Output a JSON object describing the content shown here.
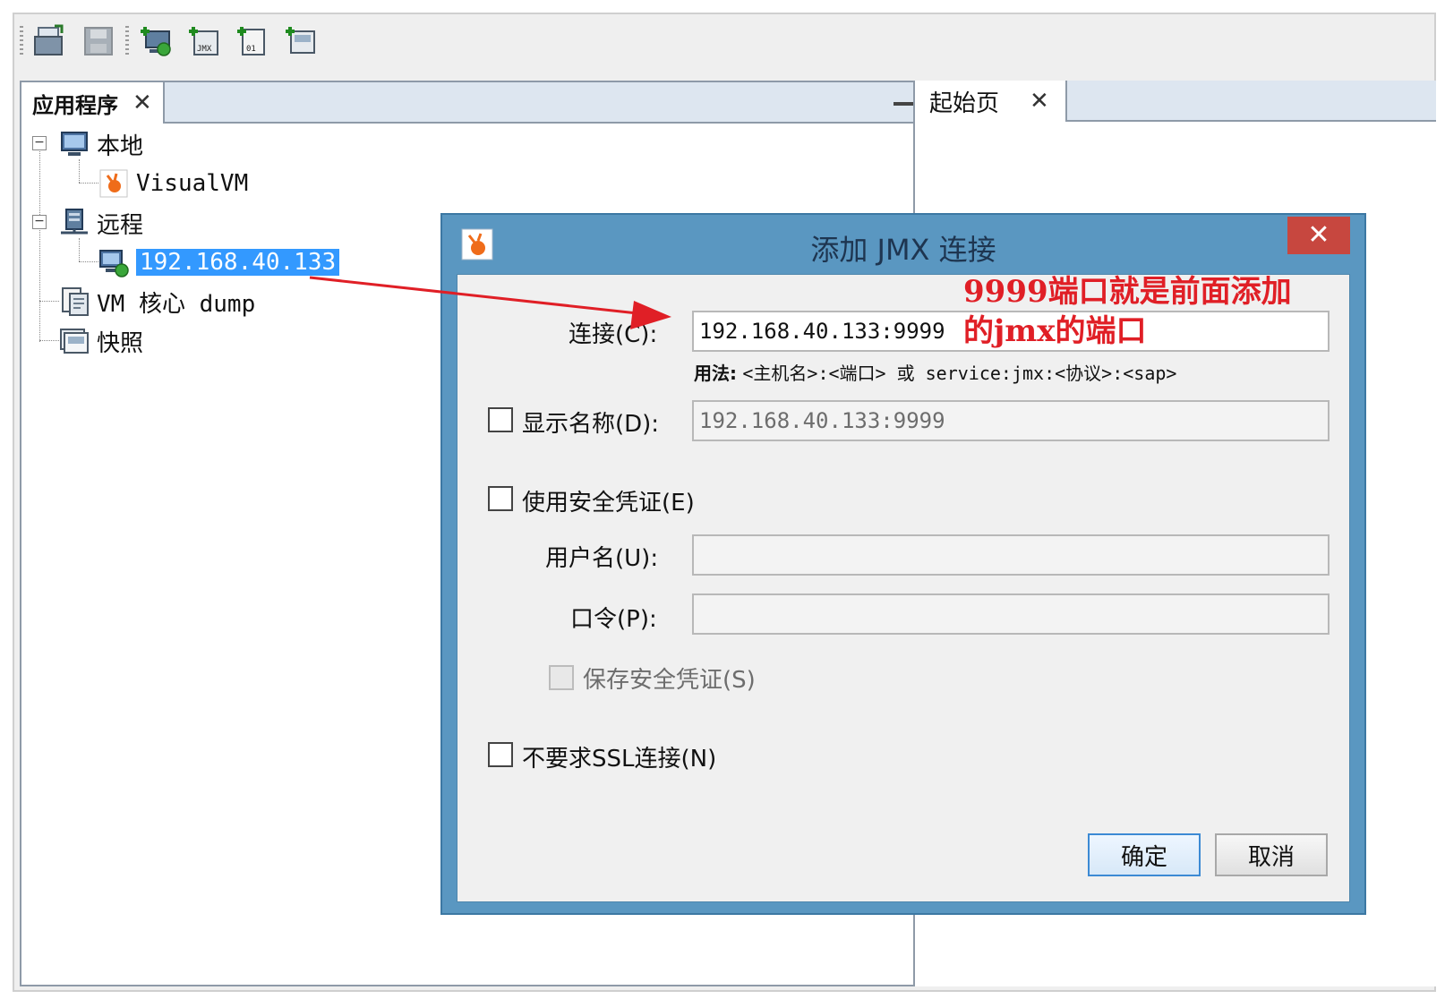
{
  "colors": {
    "selection": "#3399ff",
    "dialog_frame": "#5a97c1",
    "close_button": "#c7473f",
    "annotation": "#e01f26"
  },
  "toolbar": {
    "buttons": [
      {
        "name": "load-icon"
      },
      {
        "name": "save-icon"
      },
      {
        "name": "add-remote-host-icon"
      },
      {
        "name": "add-jmx-connection-icon"
      },
      {
        "name": "load-vm-coredump-icon"
      },
      {
        "name": "add-snapshot-icon"
      }
    ]
  },
  "left_panel": {
    "tab_label": "应用程序",
    "tab_close": "✕",
    "tree": {
      "local": "本地",
      "visualvm": "VisualVM",
      "remote": "远程",
      "remote_host": "192.168.40.133",
      "coredump": "VM 核心 dump",
      "snapshots": "快照"
    }
  },
  "right_panel": {
    "tab_label": "起始页",
    "tab_close": "✕"
  },
  "dialog": {
    "title": "添加 JMX 连接",
    "close": "✕",
    "connection_label": "连接(C):",
    "connection_value": "192.168.40.133:9999",
    "usage_prefix": "用法:",
    "usage_text": "<主机名>:<端口> 或 service:jmx:<协议>:<sap>",
    "display_name_label": "显示名称(D):",
    "display_name_value": "192.168.40.133:9999",
    "use_credentials_label": "使用安全凭证(E)",
    "username_label": "用户名(U):",
    "password_label": "口令(P):",
    "save_credentials_label": "保存安全凭证(S)",
    "no_ssl_label": "不要求SSL连接(N)",
    "ok_label": "确定",
    "cancel_label": "取消"
  },
  "annotation": {
    "line1": "9999端口就是前面添加",
    "line2": "的jmx的端口"
  }
}
